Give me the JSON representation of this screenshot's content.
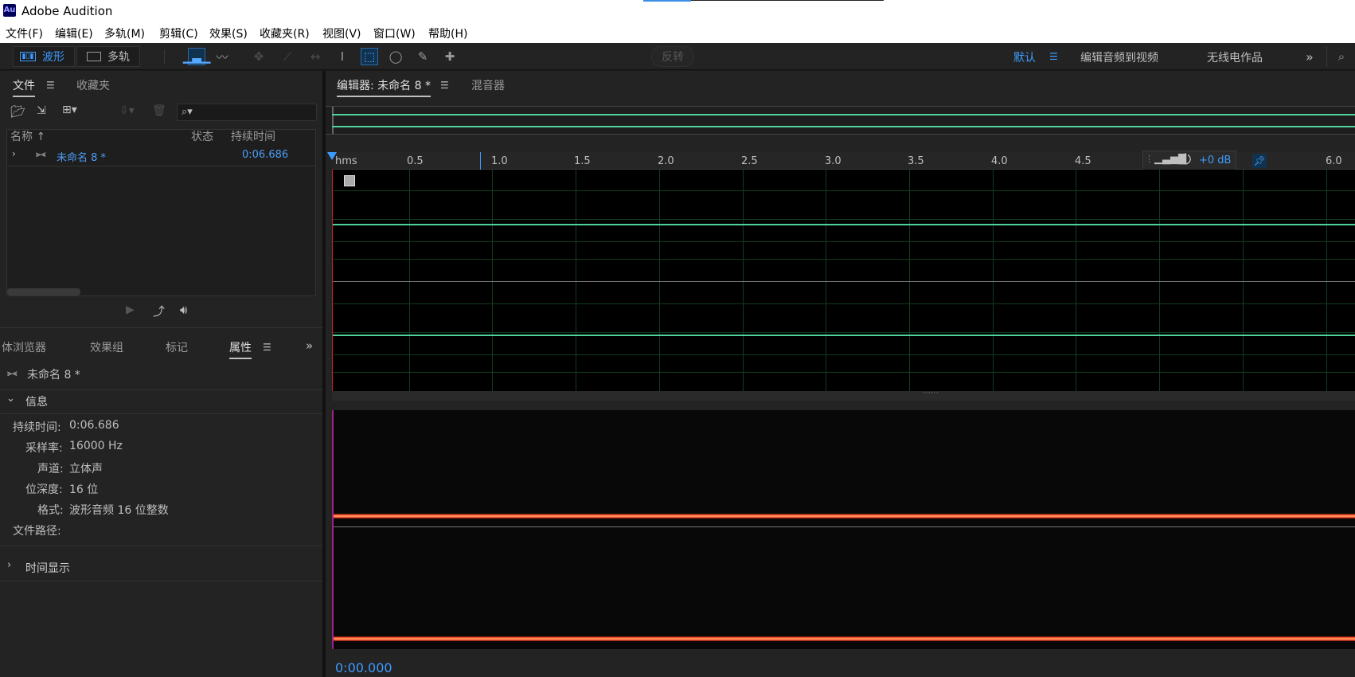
{
  "app": {
    "title": "Adobe Audition",
    "logo": "Au"
  },
  "menu": [
    "文件(F)",
    "编辑(E)",
    "多轨(M)",
    "剪辑(C)",
    "效果(S)",
    "收藏夹(R)",
    "视图(V)",
    "窗口(W)",
    "帮助(H)"
  ],
  "toolbar": {
    "waveform_label": "波形",
    "multitrack_label": "多轨",
    "reverse_label": "反转",
    "workspaces": [
      "默认",
      "编辑音频到视频",
      "无线电作品"
    ],
    "more_glyph": "»"
  },
  "files_panel": {
    "tabs": [
      "文件",
      "收藏夹"
    ],
    "columns": {
      "name": "名称 ↑",
      "status": "状态",
      "duration": "持续时间"
    },
    "rows": [
      {
        "name": "未命名 8 *",
        "duration": "0:06.686"
      }
    ]
  },
  "bottom_tabs": [
    "体浏览器",
    "效果组",
    "标记",
    "属性"
  ],
  "properties": {
    "file_name": "未命名 8 *",
    "info_header": "信息",
    "rows": [
      {
        "label": "持续时间:",
        "value": "0:06.686"
      },
      {
        "label": "采样率:",
        "value": "16000 Hz"
      },
      {
        "label": "声道:",
        "value": "立体声"
      },
      {
        "label": "位深度:",
        "value": "16 位"
      },
      {
        "label": "格式:",
        "value": "波形音频 16 位整数"
      },
      {
        "label": "文件路径:",
        "value": ""
      }
    ],
    "time_display_header": "时间显示"
  },
  "editor": {
    "tab_label": "编辑器: 未命名 8 *",
    "mixer_label": "混音器",
    "ruler_unit": "hms",
    "ruler_ticks": [
      "0.5",
      "1.0",
      "1.5",
      "2.0",
      "2.5",
      "3.0",
      "3.5",
      "4.0",
      "4.5",
      "6.0"
    ],
    "volume_label": "+0 dB",
    "time_readout": "0:00.000"
  },
  "colors": {
    "accent": "#3d9bff",
    "waveform": "#4fd19a",
    "spectral_line": "#ff4a2a",
    "playhead": "#cc2020"
  }
}
